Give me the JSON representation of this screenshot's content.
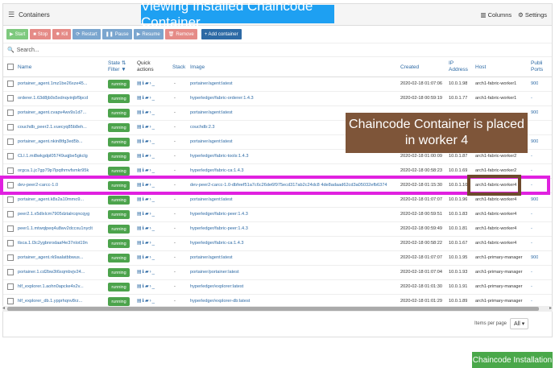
{
  "banner": "Viewing Installed Chaincode Container",
  "panel": {
    "title": "Containers",
    "columns_label": "Columns",
    "settings_label": "Settings"
  },
  "toolbar": {
    "start": "Start",
    "stop": "Stop",
    "kill": "Kill",
    "restart": "Restart",
    "pause": "Pause",
    "resume": "Resume",
    "remove": "Remove",
    "add": "+ Add container"
  },
  "search": {
    "placeholder": "Search..."
  },
  "columns": {
    "name": "Name",
    "state": "State ⇅",
    "filter": "Filter",
    "quick": "Quick",
    "actions": "actions",
    "stack": "Stack",
    "image": "Image",
    "created": "Created",
    "ip": "IP",
    "address": "Address",
    "host": "Host",
    "publi": "Publi",
    "ports": "Ports"
  },
  "status_label": "running",
  "rows": [
    {
      "name": "portainer_agent.1mz1be26xze45...",
      "stack": "-",
      "image": "portainer/agent:latest",
      "created": "2020-02-18 01:07:06",
      "ip": "10.0.1.98",
      "host": "arch1-fabric-worker1",
      "ports": "900"
    },
    {
      "name": "orderer.1.63d8jb0s5xdnqvinjbf9pcd",
      "stack": "-",
      "image": "hyperledger/fabric-orderer:1.4.3",
      "created": "2020-02-18 00:59:19",
      "ip": "10.0.1.77",
      "host": "arch1-fabric-worker1",
      "ports": "-"
    },
    {
      "name": "portainer_agent.cvapv4wv9s1d7...",
      "stack": "-",
      "image": "portainer/agent:latest",
      "created": "",
      "ip": "",
      "host": "",
      "ports": "900"
    },
    {
      "name": "couchdb_peer2.1.vuecyq85b8eh...",
      "stack": "-",
      "image": "couchdb:2.3",
      "created": "",
      "ip": "",
      "host": "",
      "ports": ""
    },
    {
      "name": "portainer_agent.nkin8tfg3ed5b...",
      "stack": "-",
      "image": "portainer/agent:latest",
      "created": "",
      "ip": "",
      "host": "",
      "ports": "900"
    },
    {
      "name": "CLI.1.mi8wkgdpl05749uqjbe5gkclg",
      "stack": "-",
      "image": "hyperledger/fabric-tools:1.4.3",
      "created": "2020-02-18 01:00:09",
      "ip": "10.0.1.87",
      "host": "arch1-fabric-worker2",
      "ports": "-"
    },
    {
      "name": "orgca.1.jc7gp79p7lpqthmvfsmkr95k",
      "stack": "-",
      "image": "hyperledger/fabric-ca:1.4.3",
      "created": "2020-02-18 00:58:23",
      "ip": "10.0.1.69",
      "host": "arch1-fabric-worker2",
      "ports": "-"
    },
    {
      "name": "dev-peer2-carcc-1.0",
      "stack": "-",
      "image": "dev-peer2-carcc-1.0-dbfeef51a7c6c26de6f975ecd317ab2c24dc8 4de8adaad62cd3a05032efb6374",
      "created": "2020-02-18 01:15:30",
      "ip": "10.0.1.100",
      "host": "arch1-fabric-worker4",
      "ports": "-"
    },
    {
      "name": "portainer_agent.k8s2a10mmo9...",
      "stack": "-",
      "image": "portainer/agent:latest",
      "created": "2020-02-18 01:07:07",
      "ip": "10.0.1.96",
      "host": "arch1-fabric-worker4",
      "ports": "900"
    },
    {
      "name": "peer2.1.x5dlxlcm7905dztalrcqncqyg",
      "stack": "-",
      "image": "hyperledger/fabric-peer:1.4.3",
      "created": "2020-02-18 00:59:51",
      "ip": "10.0.1.83",
      "host": "arch1-fabric-worker4",
      "ports": "-"
    },
    {
      "name": "peer1.1.mtwqlpeq4u8wv2dccxu1nyclt",
      "stack": "-",
      "image": "hyperledger/fabric-peer:1.4.3",
      "created": "2020-02-18 00:59:49",
      "ip": "10.0.1.81",
      "host": "arch1-fabric-worker4",
      "ports": "-"
    },
    {
      "name": "tlsca.1.l3c2ygbnrodaaf4e37nlot19n",
      "stack": "-",
      "image": "hyperledger/fabric-ca:1.4.3",
      "created": "2020-02-18 00:58:22",
      "ip": "10.0.1.67",
      "host": "arch1-fabric-worker4",
      "ports": "-"
    },
    {
      "name": "portainer_agent.rk9aalatbbwus...",
      "stack": "-",
      "image": "portainer/agent:latest",
      "created": "2020-02-18 01:07:07",
      "ip": "10.0.1.95",
      "host": "arch1-primary-manager",
      "ports": "900"
    },
    {
      "name": "portainer.1.cd2bw3t6sqmbvjv24...",
      "stack": "-",
      "image": "portainer/portainer:latest",
      "created": "2020-02-18 01:07:04",
      "ip": "10.0.1.93",
      "host": "arch1-primary-manager",
      "ports": "-"
    },
    {
      "name": "hlf_explorer.1.aohn0apcke4x2v...",
      "stack": "-",
      "image": "hyperledger/explorer:latest",
      "created": "2020-02-18 01:01:30",
      "ip": "10.0.1.91",
      "host": "arch1-primary-manager",
      "ports": "-"
    },
    {
      "name": "hlf_explorer_db.1.ypprhqnv8rz...",
      "stack": "-",
      "image": "hyperledger/explorer-db:latest",
      "created": "2020-02-18 01:01:29",
      "ip": "10.0.1.89",
      "host": "arch1-primary-manager",
      "ports": "-"
    }
  ],
  "annotation": "Chaincode Container is placed in worker 4",
  "pagination": {
    "label": "Items per page",
    "value": "All"
  },
  "footer_badge": "Chaincode Installation",
  "colors": {
    "running": "#4ca34c",
    "highlight": "#e021e0",
    "annotation": "#7e5539",
    "banner": "#1ea0f2"
  }
}
